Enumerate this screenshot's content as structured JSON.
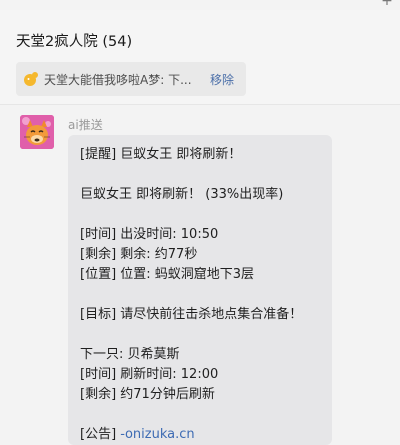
{
  "window": {
    "add_icon": "plus-icon"
  },
  "header": {
    "title": "天堂2疯人院 (54)"
  },
  "pinned": {
    "icon": "bubble-icon",
    "text": "天堂大能借我哆啦A梦: 下...",
    "remove_label": "移除"
  },
  "message": {
    "sender": "ai推送",
    "avatar": "cat-avatar",
    "lines": [
      "[提醒] 巨蚁女王 即将刷新！",
      "巨蚁女王 即将刷新！ (33%出现率)",
      "[时间] 出没时间: 10:50",
      "[剩余] 剩余: 约77秒",
      "[位置] 位置: 蚂蚁洞窟地下3层",
      "[目标] 请尽快前往击杀地点集合准备！",
      "下一只: 贝希莫斯",
      "[时间] 刷新时间: 12:00",
      "[剩余] 约71分钟后刷新",
      "[公告] ",
      "-onizuka.cn"
    ]
  },
  "colors": {
    "link": "#3d6bb3",
    "bubble": "#e6e6e8",
    "avatar_bg": "#e05faa"
  }
}
